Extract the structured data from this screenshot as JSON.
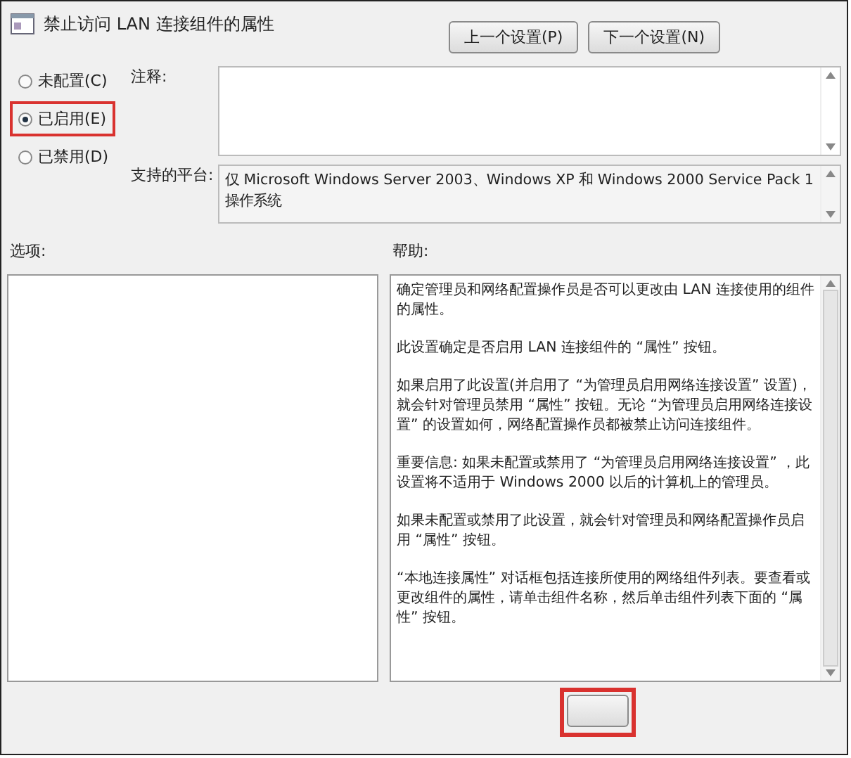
{
  "window": {
    "title": "禁止访问 LAN 连接组件的属性"
  },
  "nav_buttons": [
    "上一个设置(P)",
    "下一个设置(N)"
  ],
  "state_options": [
    {
      "label": "未配置(C)",
      "selected": false,
      "highlighted": false
    },
    {
      "label": "已启用(E)",
      "selected": true,
      "highlighted": true
    },
    {
      "label": "已禁用(D)",
      "selected": false,
      "highlighted": false
    }
  ],
  "comment": {
    "label": "注释:"
  },
  "supported_on": {
    "label": "支持的平台:",
    "value": "仅 Microsoft Windows Server 2003、Windows XP 和 Windows 2000 Service Pack 1 操作系统"
  },
  "options": {
    "label": "选项:"
  },
  "help": {
    "label": "帮助:",
    "paragraphs": [
      "确定管理员和网络配置操作员是否可以更改由 LAN 连接使用的组件的属性。",
      "此设置确定是否启用 LAN 连接组件的 “属性” 按钮。",
      "如果启用了此设置(并启用了 “为管理员启用网络连接设置” 设置)，就会针对管理员禁用 “属性” 按钮。无论 “为管理员启用网络连接设置” 的设置如何，网络配置操作员都被禁止访问连接组件。",
      "重要信息: 如果未配置或禁用了 “为管理员启用网络连接设置” ，此设置将不适用于 Windows 2000 以后的计算机上的管理员。",
      "如果未配置或禁用了此设置，就会针对管理员和网络配置操作员启用 “属性” 按钮。",
      " “本地连接属性” 对话框包括连接所使用的网络组件列表。要查看或更改组件的属性，请单击组件名称，然后单击组件列表下面的 “属性” 按钮。"
    ]
  },
  "footer_button": {
    "highlighted": true
  }
}
